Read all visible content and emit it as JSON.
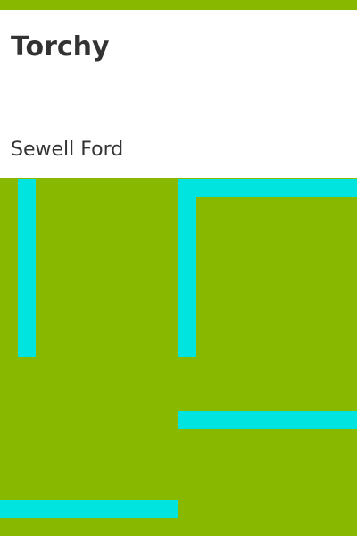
{
  "book": {
    "title": "Torchy",
    "author": "Sewell Ford"
  },
  "colors": {
    "background": "#88b800",
    "panel": "#ffffff",
    "text": "#333333",
    "accent": "#00e4e0"
  }
}
